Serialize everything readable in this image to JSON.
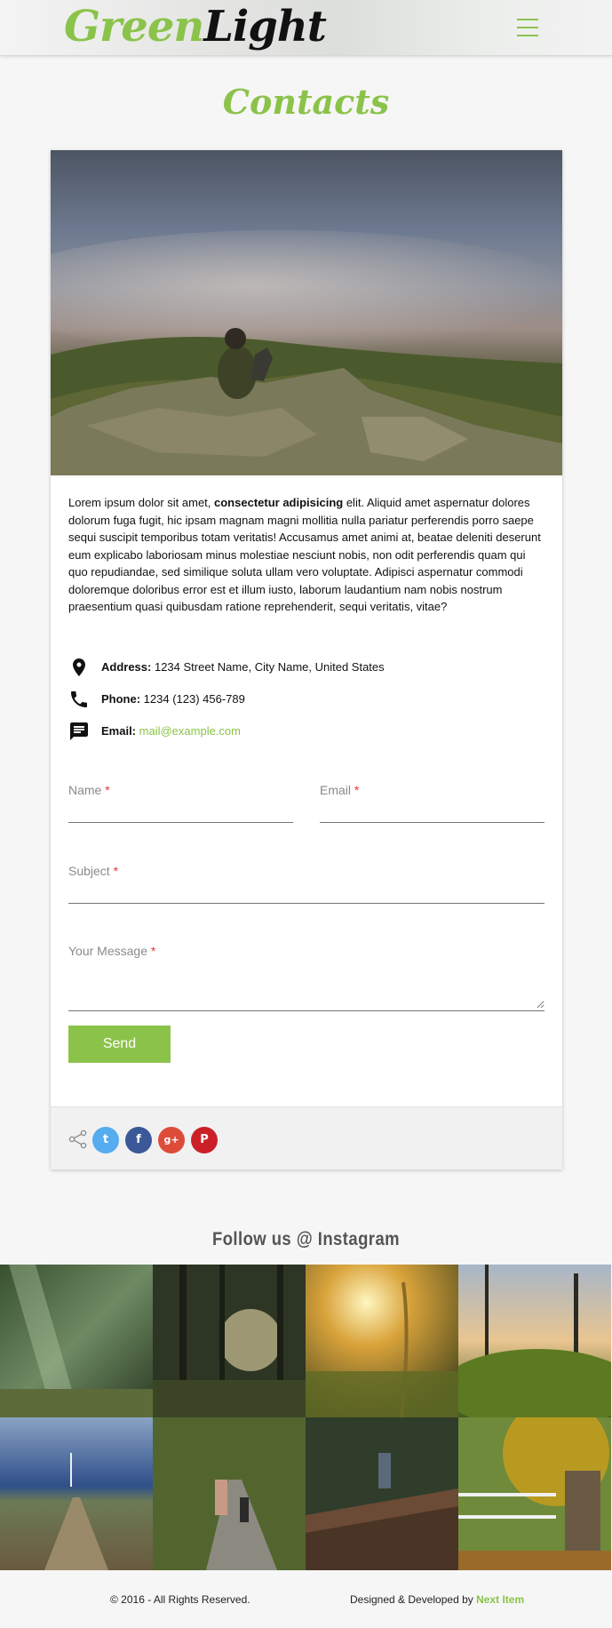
{
  "header": {
    "logo_green": "Green",
    "logo_dark": "Light",
    "menu_icon": "hamburger-icon"
  },
  "page": {
    "title": "Contacts"
  },
  "card": {
    "intro_start": "Lorem ipsum dolor sit amet, ",
    "intro_bold": "consectetur adipisicing",
    "intro_end": " elit. Aliquid amet aspernatur dolores dolorum fuga fugit, hic ipsam magnam magni mollitia nulla pariatur perferendis porro saepe sequi suscipit temporibus totam veritatis! Accusamus amet animi at, beatae deleniti deserunt eum explicabo laboriosam minus molestiae nesciunt nobis, non odit perferendis quam qui quo repudiandae, sed similique soluta ullam vero voluptate. Adipisci aspernatur commodi doloremque doloribus error est et illum iusto, laborum laudantium nam nobis nostrum praesentium quasi quibusdam ratione reprehenderit, sequi veritatis, vitae?",
    "contact": {
      "address_label": "Address:",
      "address_value": " 1234 Street Name, City Name, United States",
      "phone_label": "Phone:",
      "phone_value": " 1234 (123) 456-789",
      "email_label": "Email:",
      "email_value": "mail@example.com"
    },
    "form": {
      "name_label": "Name",
      "email_label": "Email",
      "subject_label": "Subject",
      "message_label": "Your Message",
      "required_mark": "*",
      "send_label": "Send"
    },
    "share": {
      "twitter": "t",
      "facebook": "f",
      "googleplus": "g+",
      "pinterest": "P"
    }
  },
  "instagram": {
    "title": "Follow us @ Instagram"
  },
  "footer": {
    "copyright": "© 2016 - All Rights Reserved.",
    "credit_prefix": "Designed & Developed by ",
    "credit_link": "Next Item"
  },
  "colors": {
    "accent": "#8bc34a",
    "required": "#e53935",
    "twitter": "#55acee",
    "facebook": "#3b5998",
    "googleplus": "#dd4b39",
    "pinterest": "#cb2027"
  }
}
